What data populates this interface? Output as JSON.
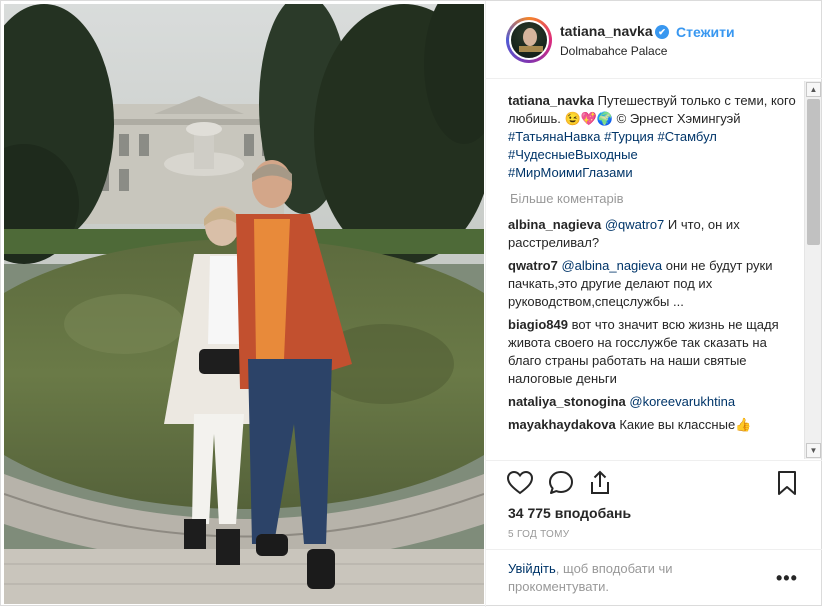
{
  "header": {
    "username": "tatiana_navka",
    "verified_mark": "✔",
    "follow_label": "Стежити",
    "location": "Dolmabahce Palace"
  },
  "caption": {
    "username": "tatiana_navka",
    "text": "Путешествуй только с теми, кого любишь. 😉💖🌍 © Эрнест Хэмингуэй",
    "hashtags": [
      "#ТатьянаНавка",
      "#Турция",
      "#Стамбул",
      "#ЧудесныеВыходные",
      "#МирМоимиГлазами"
    ]
  },
  "more_comments_label": "Більше коментарів",
  "comments": [
    {
      "username": "albina_nagieva",
      "mention": "@qwatro7",
      "text": "И что, он их расстреливал?"
    },
    {
      "username": "qwatro7",
      "mention": "@albina_nagieva",
      "text": "они не будут руки пачкать,это другие делают под их руководством,спецслужбы ..."
    },
    {
      "username": "biagio849",
      "mention": "",
      "text": "вот что значит всю жизнь не щадя живота своего на госслужбе так сказать на благо страны работать на наши святые налоговые деньги"
    },
    {
      "username": "nataliya_stonogina",
      "mention": "@koreevarukhtina",
      "text": ""
    },
    {
      "username": "mayakhaydakova",
      "mention": "",
      "text": "Какие вы классные👍"
    }
  ],
  "actions": {
    "like_icon": "heart-outline",
    "comment_icon": "speech-bubble",
    "share_icon": "share-arrow",
    "save_icon": "bookmark"
  },
  "likes_text": "34 775 вподобань",
  "time_ago": "5 ГОД ТОМУ",
  "login": {
    "link": "Увійдіть",
    "text": ", щоб вподобати чи прокоментувати."
  },
  "more_options_label": "•••",
  "scrollbar": {
    "up": "▲",
    "down": "▼"
  },
  "colors": {
    "link": "#3897f0",
    "hashtag": "#003569",
    "muted": "#999999",
    "text": "#262626"
  }
}
